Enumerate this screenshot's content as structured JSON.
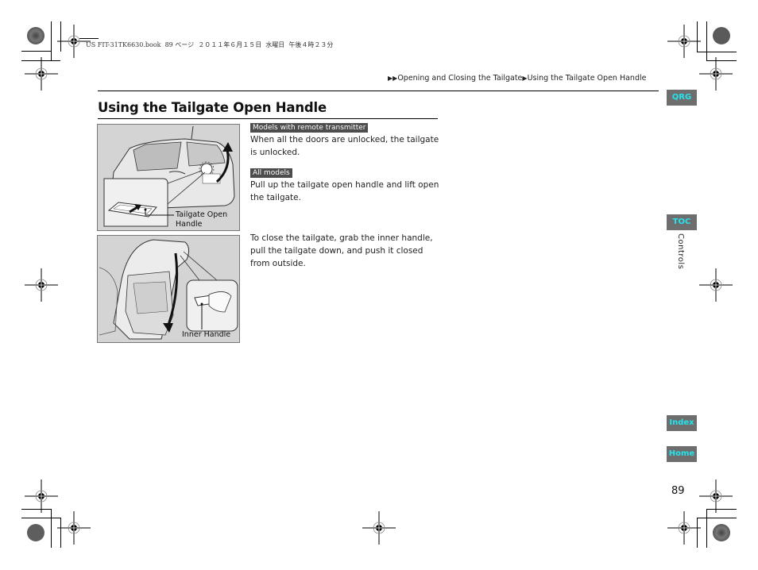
{
  "print_info": {
    "line": "US FIT-31TK6630.book  89 ページ  ２０１１年６月１５日  水曜日  午後４時２３分"
  },
  "breadcrumb": {
    "items": [
      "Opening and Closing the Tailgate",
      "Using the Tailgate Open Handle"
    ],
    "separator_icon": "right-triangle-icon"
  },
  "page": {
    "title": "Using the Tailgate Open Handle",
    "number": "89"
  },
  "figures": [
    {
      "name": "tailgate-open-handle-illustration",
      "caption": "Tailgate Open Handle",
      "caption_line1": "Tailgate Open",
      "caption_line2": "Handle"
    },
    {
      "name": "inner-handle-illustration",
      "caption": "Inner Handle"
    }
  ],
  "sections": [
    {
      "tag": "Models with remote transmitter",
      "text": "When all the doors are unlocked, the tailgate is unlocked."
    },
    {
      "tag": "All models",
      "text": "Pull up the tailgate open handle and lift open the tailgate."
    },
    {
      "tag": "",
      "text": "To close the tailgate, grab the inner handle, pull the tailgate down, and push it closed from outside."
    }
  ],
  "side_nav": {
    "qrg": "QRG",
    "toc": "TOC",
    "chapter": "Controls",
    "index": "Index",
    "home": "Home"
  },
  "colors": {
    "tab_background": "#6e6e6e",
    "tab_text": "#23e4ee",
    "tag_background": "#4d4d4d"
  }
}
